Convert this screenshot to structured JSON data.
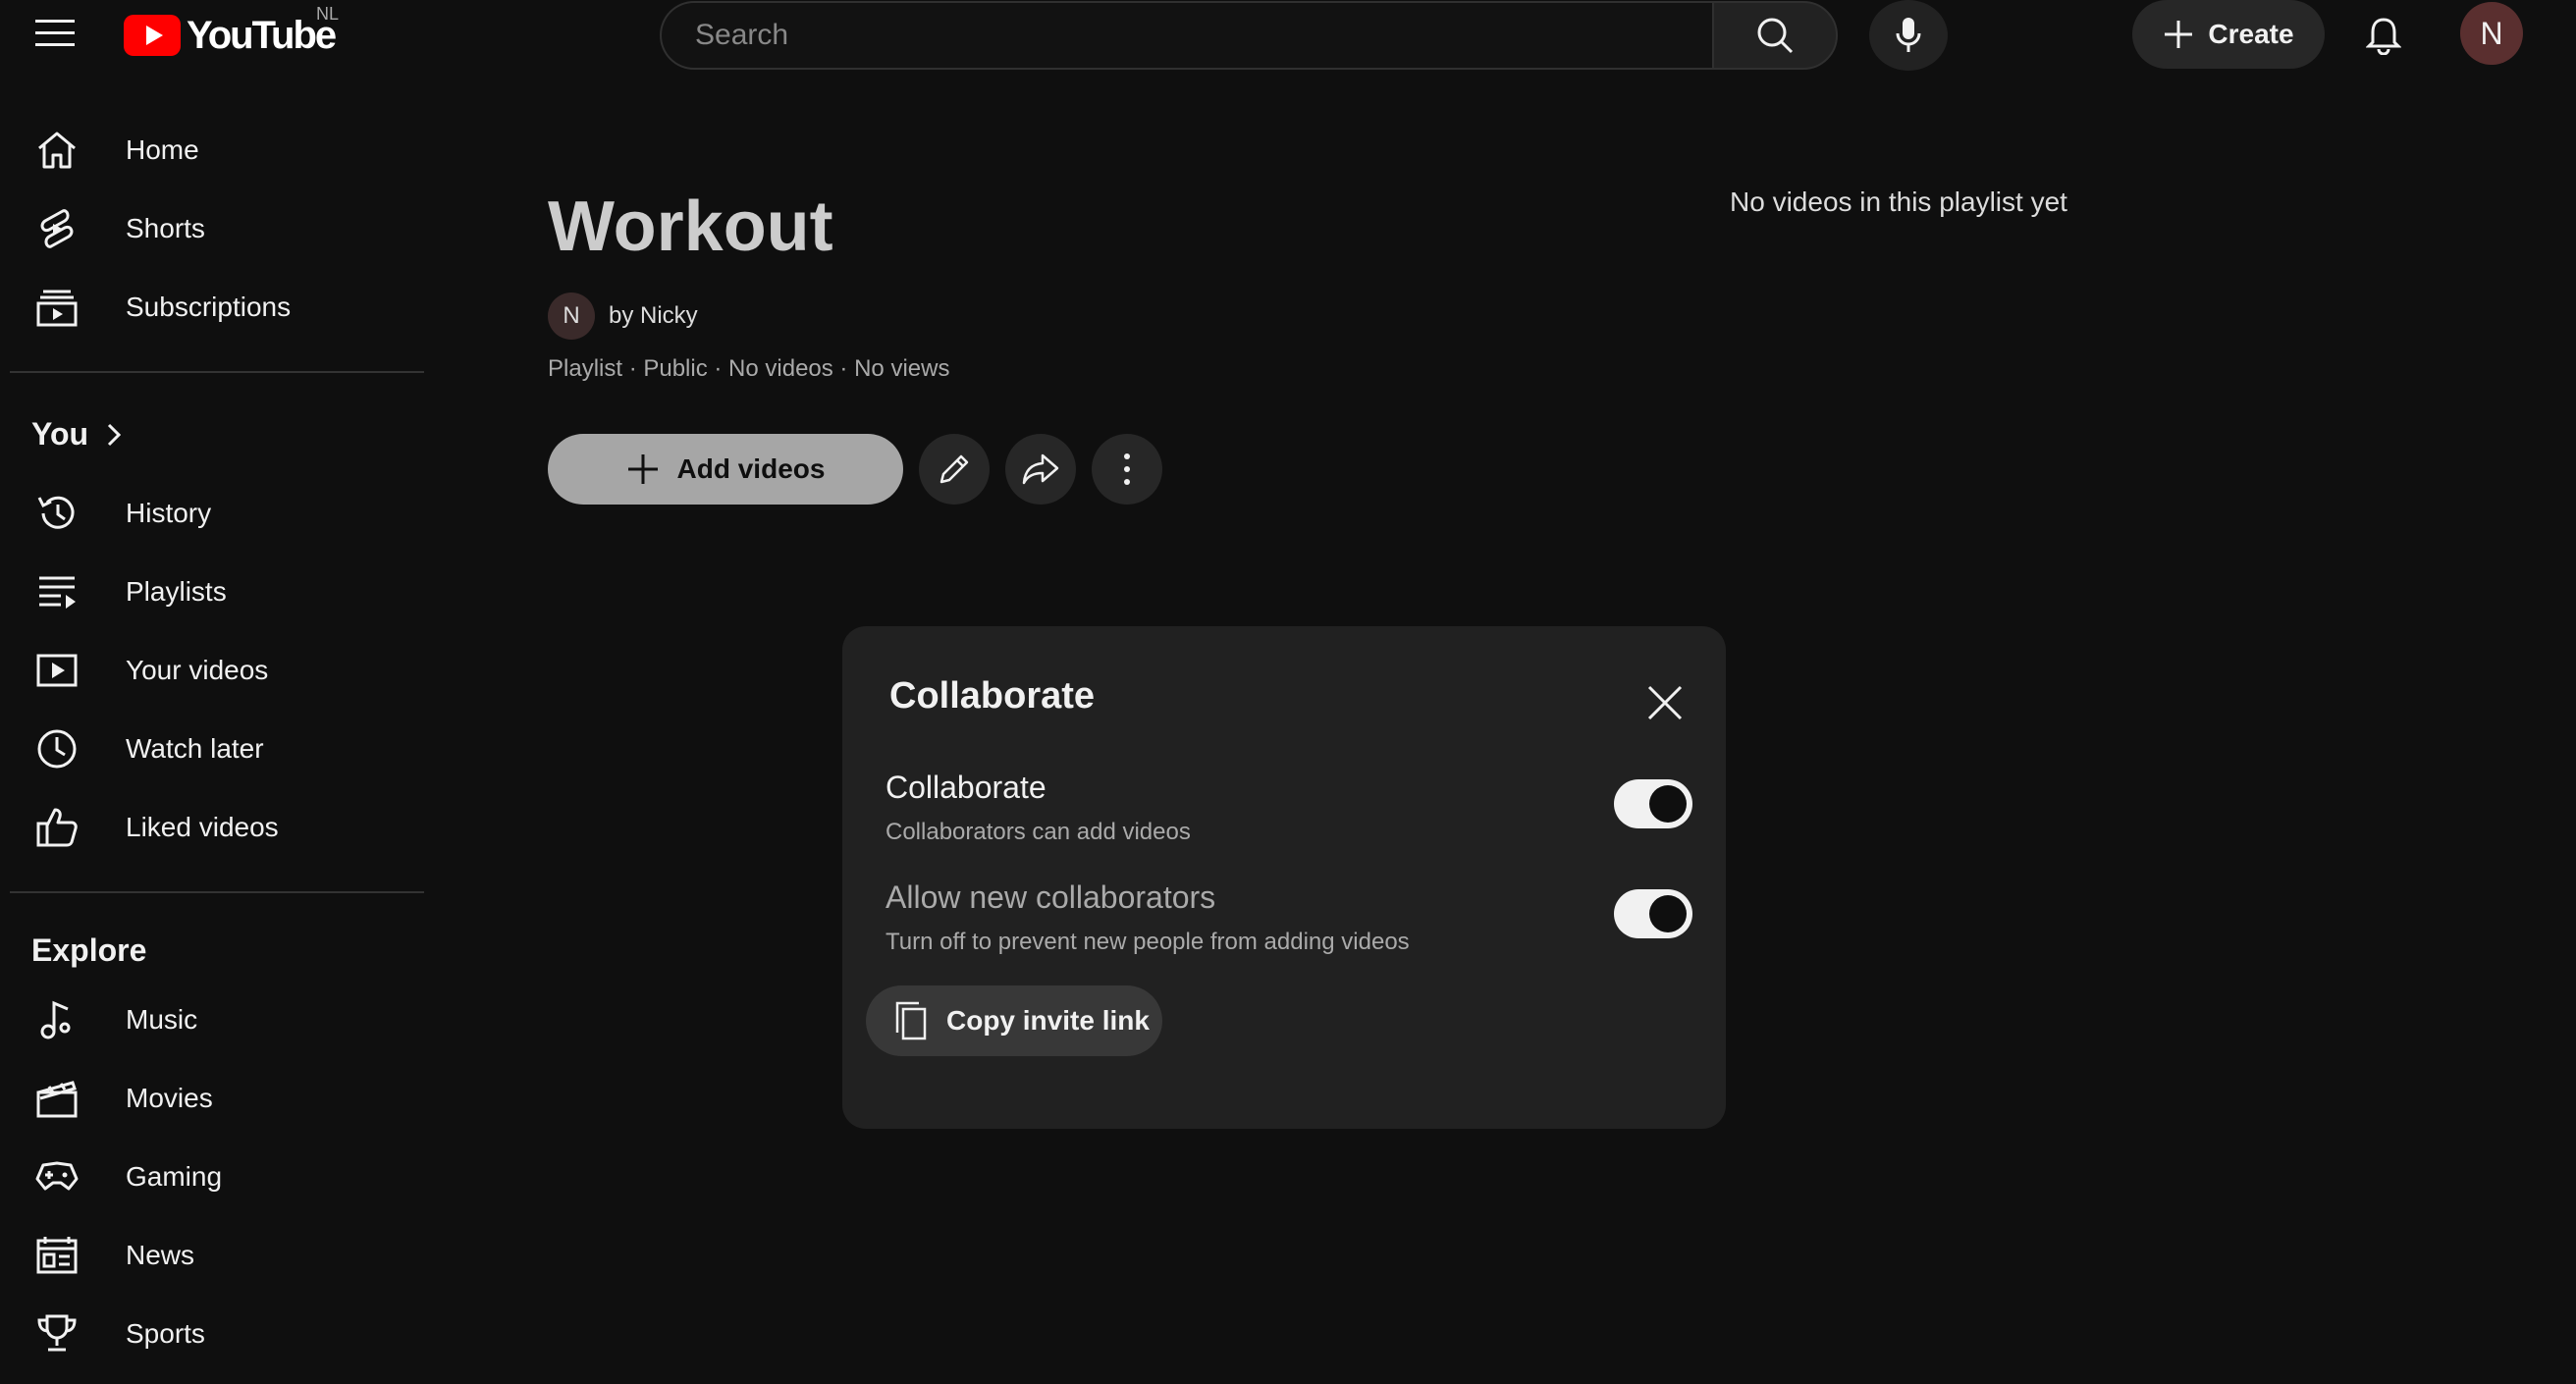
{
  "header": {
    "logo_text": "YouTube",
    "region": "NL",
    "search_placeholder": "Search",
    "create_label": "Create",
    "avatar_initial": "N"
  },
  "sidebar": {
    "main": [
      {
        "label": "Home",
        "icon": "home-icon"
      },
      {
        "label": "Shorts",
        "icon": "shorts-icon"
      },
      {
        "label": "Subscriptions",
        "icon": "subscriptions-icon"
      }
    ],
    "you_title": "You",
    "you": [
      {
        "label": "History",
        "icon": "history-icon"
      },
      {
        "label": "Playlists",
        "icon": "playlists-icon"
      },
      {
        "label": "Your videos",
        "icon": "your-videos-icon"
      },
      {
        "label": "Watch later",
        "icon": "watch-later-icon"
      },
      {
        "label": "Liked videos",
        "icon": "liked-videos-icon"
      }
    ],
    "explore_title": "Explore",
    "explore": [
      {
        "label": "Music",
        "icon": "music-icon"
      },
      {
        "label": "Movies",
        "icon": "movies-icon"
      },
      {
        "label": "Gaming",
        "icon": "gaming-icon"
      },
      {
        "label": "News",
        "icon": "news-icon"
      },
      {
        "label": "Sports",
        "icon": "sports-icon"
      }
    ]
  },
  "playlist": {
    "title": "Workout",
    "owner_initial": "N",
    "owner": "by Nicky",
    "meta": "Playlist · Public · No videos · No views",
    "add_videos_label": "Add videos",
    "empty_message": "No videos in this playlist yet"
  },
  "dialog": {
    "title": "Collaborate",
    "options": [
      {
        "label": "Collaborate",
        "description": "Collaborators can add videos",
        "enabled": true
      },
      {
        "label": "Allow new collaborators",
        "description": "Turn off to prevent new people from adding videos",
        "enabled": true
      }
    ],
    "copy_link_label": "Copy invite link"
  },
  "colors": {
    "background": "#0f0f0f",
    "brand_red": "#ff0000",
    "dialog_bg": "#212121"
  }
}
